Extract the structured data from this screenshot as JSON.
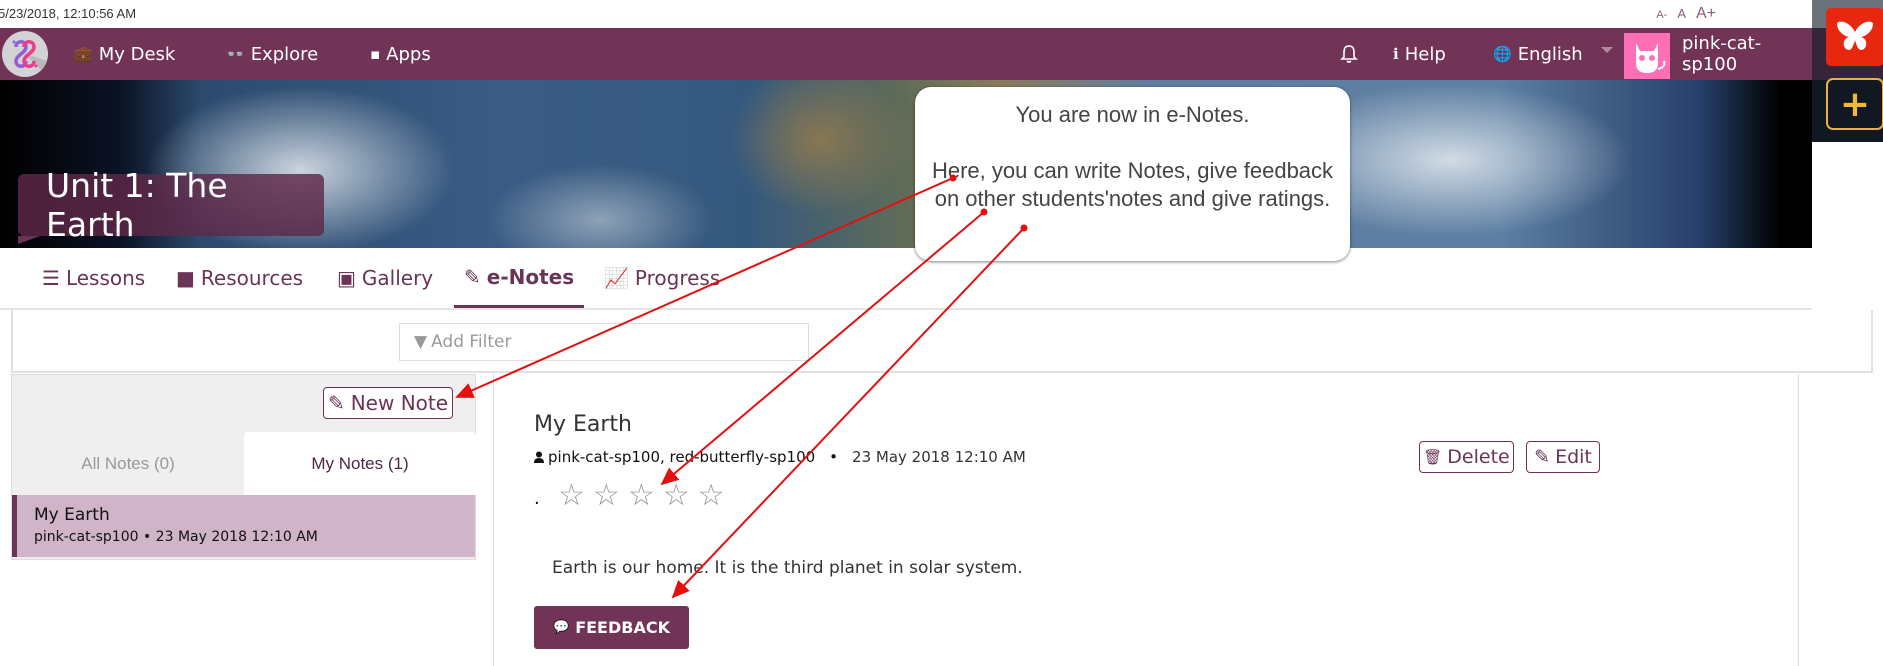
{
  "topbar": {
    "timestamp": "5/23/2018, 12:10:56 AM",
    "font_size_controls": [
      "A-",
      "A",
      "A+"
    ]
  },
  "navbar": {
    "items": [
      {
        "label": "My Desk",
        "icon": "briefcase-icon",
        "glyph": "💼"
      },
      {
        "label": "Explore",
        "icon": "binoculars-icon",
        "glyph": "👓"
      },
      {
        "label": "Apps",
        "icon": "apps-icon",
        "glyph": "▪"
      }
    ],
    "notifications_icon": "🔔",
    "help": {
      "label": "Help",
      "glyph": "ℹ"
    },
    "language": {
      "label": "English",
      "glyph": "🌐"
    },
    "user": {
      "name": "pink-cat-sp100"
    }
  },
  "side_rail": {
    "plus_label": "+"
  },
  "banner": {
    "unit_title": "Unit 1: The Earth"
  },
  "callout": {
    "line1": "You are now in e-Notes.",
    "line2": "Here, you can write Notes, give feedback on other students'notes and give ratings."
  },
  "tabs": [
    {
      "label": "Lessons",
      "glyph": "☰",
      "active": false
    },
    {
      "label": "Resources",
      "glyph": "■",
      "active": false
    },
    {
      "label": "Gallery",
      "glyph": "▣",
      "active": false
    },
    {
      "label": "e-Notes",
      "glyph": "✎",
      "active": true
    },
    {
      "label": "Progress",
      "glyph": "📈",
      "active": false
    }
  ],
  "filter": {
    "placeholder": "Add Filter",
    "glyph": "▼"
  },
  "left_panel": {
    "new_note_label": "New Note",
    "new_note_glyph": "✎",
    "tabs": [
      {
        "label": "All Notes (0)",
        "active": false
      },
      {
        "label": "My Notes (1)",
        "active": true
      }
    ],
    "notes": [
      {
        "title": "My Earth",
        "meta": "pink-cat-sp100 • 23 May 2018 12:10 AM",
        "selected": true
      }
    ]
  },
  "note_detail": {
    "title": "My Earth",
    "authors": "pink-cat-sp100, red-butterfly-sp100",
    "separator": "•",
    "date": "23 May 2018 12:10 AM",
    "rating_prefix": ".",
    "rating": 0,
    "rating_max": 5,
    "star_glyph": "☆",
    "delete_label": "Delete",
    "delete_glyph": "🗑",
    "edit_label": "Edit",
    "edit_glyph": "✎",
    "body": "Earth is our home. It is the third planet in solar system.",
    "feedback_label": "FEEDBACK",
    "feedback_glyph": "💬"
  },
  "colors": {
    "brand": "#713456",
    "selected_note_bg": "#d0b5c9",
    "annotation_red": "#e41010",
    "rail_red": "#e8280e",
    "rail_gold": "#f3b63c"
  }
}
